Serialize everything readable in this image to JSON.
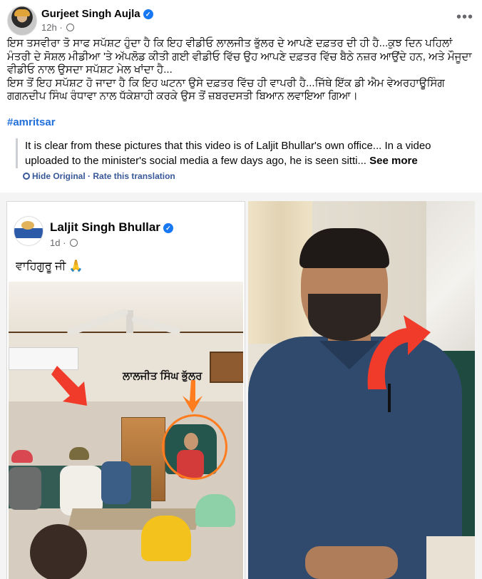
{
  "post": {
    "author": "Gurjeet Singh Aujla",
    "time": "12h",
    "text_line1": "ਇਸ ਤਸਵੀਰਾ ਤੋ ਸਾਫ ਸਪੱਸ਼ਟ ਹੁੰਦਾ ਹੈ ਕਿ ਇਹ ਵੀਡੀਓ ਲਾਲਜੀਤ ਭੁੱਲਰ ਦੇ ਆਪਣੇ ਦਫ਼ਤਰ ਦੀ ਹੀ ਹੈ...ਕੁਝ ਦਿਨ ਪਹਿਲਾਂ ਮੰਤਰੀ ਦੇ ਸੋਸ਼ਲ ਮੀਡੀਆ 'ਤੇ ਅੱਪਲੋਡ ਕੀਤੀ ਗਈ ਵੀਡੀਓ ਵਿੱਚ ਉਹ ਆਪਣੇ ਦਫ਼ਤਰ ਵਿੱਚ ਬੈਠੇ ਨਜ਼ਰ ਆਉਂਦੇ ਹਨ, ਅਤੇ ਮੌਜੂਦਾ ਵੀਡੀਓ ਨਾਲ ਉਸਦਾ ਸਪੱਸ਼ਟ ਮੇਲ ਖਾਂਦਾ ਹੈ...",
    "text_line2": "ਇਸ ਤੋਂ ਇਹ ਸਪੱਸ਼ਟ ਹੋ ਜਾਦਾ ਹੈ ਕਿ ਇਹ ਘਟਨਾ ਉਸੇ ਦਫ਼ਤਰ ਵਿੱਚ ਹੀ ਵਾਪਰੀ ਹੈ...ਜਿੱਥੇ ਇੱਕ ਡੀ ਐਮ ਵੇਅਰਹਾਊਸਿੰਗ ਗਗਨਦੀਪ ਸਿੰਘ ਰੰਧਾਵਾ ਨਾਲ ਧੱਕੇਸ਼ਾਹੀ ਕਰਕੇ ਉਸ ਤੋਂ ਜ਼ਬਰਦਸਤੀ ਬਿਆਨ ਲਵਾਇਆ ਗਿਆ।",
    "hashtag": "#amritsar",
    "translation": "It is clear from these pictures that this video is of Laljit Bhullar's own office... In a video uploaded to the minister's social media a few days ago, he is seen sitti...",
    "see_more": "See more",
    "hide_original": "Hide Original",
    "separator": "·",
    "rate_translation": "Rate this translation"
  },
  "embedded": {
    "name": "Laljit Singh Bhullar",
    "time": "1d",
    "text": "ਵਾਹਿਗੁਰੂ ਜੀ 🙏",
    "label": "ਲਾਲਜੀਤ ਸਿੰਘ ਭੁੱਲਰ"
  },
  "colors": {
    "link": "#216fdb",
    "verified": "#1877f2",
    "arrow_red": "#f03a2a",
    "arrow_orange": "#ff7c1f"
  },
  "icons": [
    "verified-badge-icon",
    "globe-icon",
    "more-options-icon",
    "translate-icon"
  ]
}
